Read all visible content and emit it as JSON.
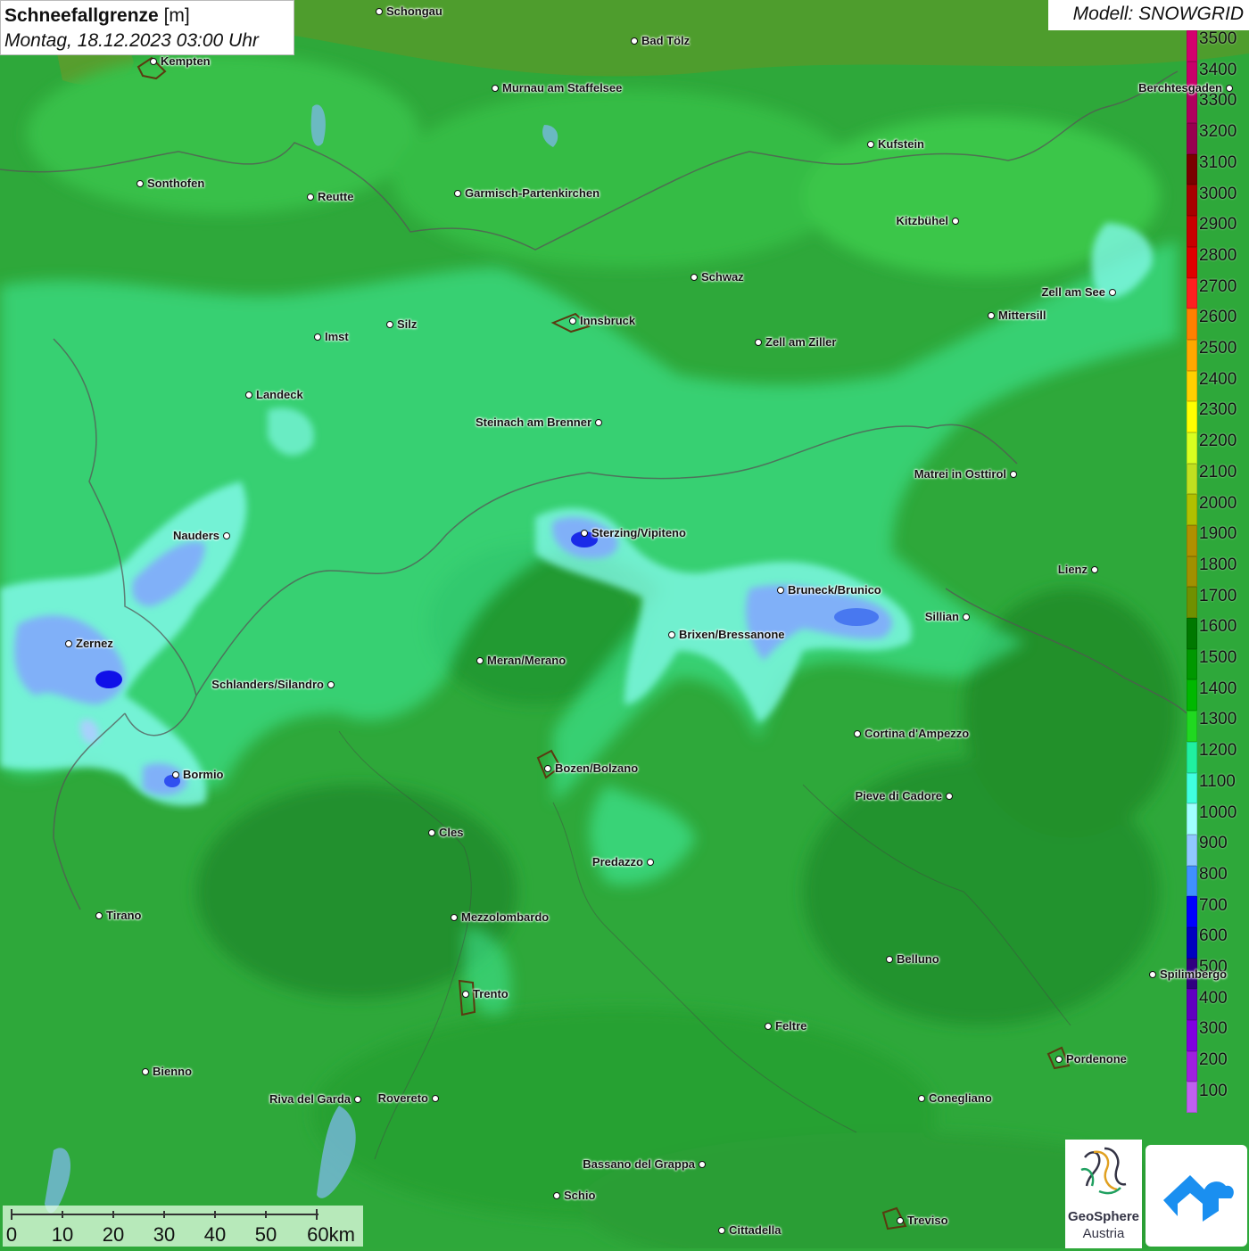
{
  "title": {
    "parameter": "Schneefallgrenze",
    "unit": "[m]",
    "datetime": "Montag, 18.12.2023 03:00 Uhr"
  },
  "model": "Modell: SNOWGRID",
  "legend": {
    "labels": [
      "3500",
      "3400",
      "3300",
      "3200",
      "3100",
      "3000",
      "2900",
      "2800",
      "2700",
      "2600",
      "2500",
      "2400",
      "2300",
      "2200",
      "2100",
      "2000",
      "1900",
      "1800",
      "1700",
      "1600",
      "1500",
      "1400",
      "1300",
      "1200",
      "1100",
      "1000",
      "900",
      "800",
      "700",
      "600",
      "500",
      "400",
      "300",
      "200",
      "100"
    ],
    "colors": [
      "#d4006e",
      "#c8006a",
      "#b0005e",
      "#980050",
      "#7a0000",
      "#a80000",
      "#c80000",
      "#e00000",
      "#ff2020",
      "#ff8000",
      "#ffa800",
      "#ffd000",
      "#ffff00",
      "#d8ff20",
      "#c0e020",
      "#b0c000",
      "#b09000",
      "#a09000",
      "#709000",
      "#007800",
      "#009800",
      "#00b800",
      "#20d820",
      "#20f0a0",
      "#40ffe0",
      "#a0ffff",
      "#90c8ff",
      "#4090ff",
      "#0000ff",
      "#0000c0",
      "#300080",
      "#6000c0",
      "#8000e0",
      "#a020e0",
      "#c060f0"
    ]
  },
  "scale": {
    "labels": [
      "0",
      "10",
      "20",
      "30",
      "40",
      "50",
      "60km"
    ]
  },
  "logos": {
    "geosphere_line1": "GeoSphere",
    "geosphere_line2": "Austria"
  },
  "places": [
    {
      "name": "Schongau",
      "anchor": "left"
    },
    {
      "name": "Bad Tölz",
      "anchor": "left"
    },
    {
      "name": "Kempten",
      "anchor": "left"
    },
    {
      "name": "Murnau am Staffelsee",
      "anchor": "left"
    },
    {
      "name": "Berchtesgaden",
      "anchor": "right"
    },
    {
      "name": "Kufstein",
      "anchor": "left"
    },
    {
      "name": "Sonthofen",
      "anchor": "left"
    },
    {
      "name": "Reutte",
      "anchor": "left"
    },
    {
      "name": "Garmisch-Partenkirchen",
      "anchor": "left"
    },
    {
      "name": "Kitzbühel",
      "anchor": "right"
    },
    {
      "name": "Schwaz",
      "anchor": "left"
    },
    {
      "name": "Zell am See",
      "anchor": "right"
    },
    {
      "name": "Mittersill",
      "anchor": "left"
    },
    {
      "name": "Innsbruck",
      "anchor": "left"
    },
    {
      "name": "Imst",
      "anchor": "left"
    },
    {
      "name": "Silz",
      "anchor": "left"
    },
    {
      "name": "Zell am Ziller",
      "anchor": "left"
    },
    {
      "name": "Landeck",
      "anchor": "left"
    },
    {
      "name": "Steinach am Brenner",
      "anchor": "right"
    },
    {
      "name": "Matrei in Osttirol",
      "anchor": "right"
    },
    {
      "name": "Nauders",
      "anchor": "right"
    },
    {
      "name": "Sterzing/Vipiteno",
      "anchor": "left"
    },
    {
      "name": "Lienz",
      "anchor": "right"
    },
    {
      "name": "Bruneck/Brunico",
      "anchor": "left"
    },
    {
      "name": "Sillian",
      "anchor": "right"
    },
    {
      "name": "Zernez",
      "anchor": "left"
    },
    {
      "name": "Brixen/Bressanone",
      "anchor": "left"
    },
    {
      "name": "Meran/Merano",
      "anchor": "left"
    },
    {
      "name": "Schlanders/Silandro",
      "anchor": "right"
    },
    {
      "name": "Cortina d'Ampezzo",
      "anchor": "left"
    },
    {
      "name": "Bozen/Bolzano",
      "anchor": "left"
    },
    {
      "name": "Bormio",
      "anchor": "left"
    },
    {
      "name": "Pieve di Cadore",
      "anchor": "right"
    },
    {
      "name": "Cles",
      "anchor": "left"
    },
    {
      "name": "Predazzo",
      "anchor": "right"
    },
    {
      "name": "Tirano",
      "anchor": "left"
    },
    {
      "name": "Mezzolombardo",
      "anchor": "left"
    },
    {
      "name": "Belluno",
      "anchor": "left"
    },
    {
      "name": "Spilimbergo",
      "anchor": "left"
    },
    {
      "name": "Trento",
      "anchor": "left"
    },
    {
      "name": "Feltre",
      "anchor": "left"
    },
    {
      "name": "Pordenone",
      "anchor": "left"
    },
    {
      "name": "Bienno",
      "anchor": "left"
    },
    {
      "name": "Riva del Garda",
      "anchor": "right"
    },
    {
      "name": "Rovereto",
      "anchor": "right"
    },
    {
      "name": "Conegliano",
      "anchor": "left"
    },
    {
      "name": "Bassano del Grappa",
      "anchor": "right"
    },
    {
      "name": "Schio",
      "anchor": "left"
    },
    {
      "name": "Treviso",
      "anchor": "left"
    },
    {
      "name": "Cittadella",
      "anchor": "left"
    }
  ]
}
